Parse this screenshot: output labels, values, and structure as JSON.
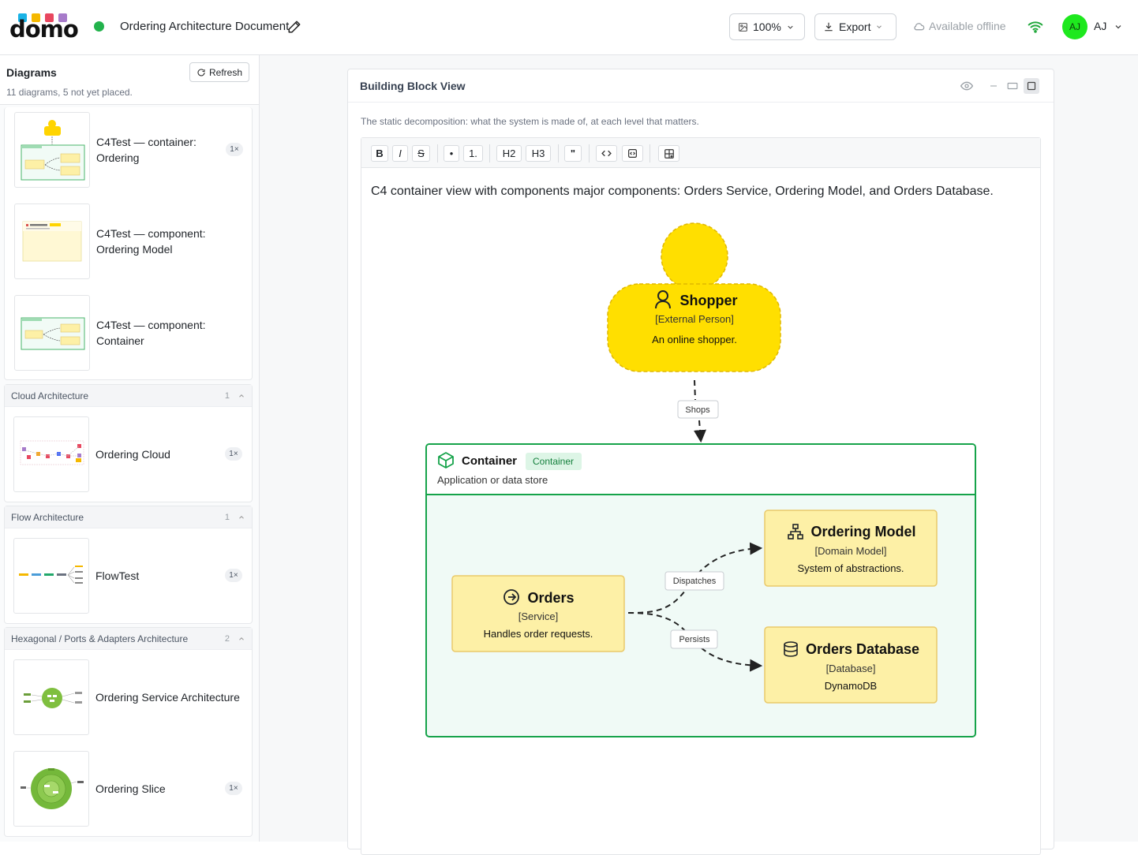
{
  "header": {
    "logo_text": "domo",
    "logo_colors": [
      "#1ab3e6",
      "#f5b800",
      "#e8475f",
      "#a77bca"
    ],
    "status_color": "#22b24c",
    "doc_title": "Ordering Architecture Document",
    "zoom": "100%",
    "export_label": "Export",
    "offline_label": "Available offline",
    "wifi_color": "#22a83c",
    "avatar_initials": "AJ",
    "avatar_color": "#1ee81e",
    "user_label": "AJ"
  },
  "sidebar": {
    "title": "Diagrams",
    "refresh_label": "Refresh",
    "summary": "11 diagrams, 5 not yet placed.",
    "top_items": [
      {
        "label": "C4Test — container: Ordering",
        "badge": "1×"
      },
      {
        "label": "C4Test — component: Ordering Model"
      },
      {
        "label": "C4Test — component: Container"
      }
    ],
    "groups": [
      {
        "name": "Cloud Architecture",
        "count": "1",
        "items": [
          {
            "label": "Ordering Cloud",
            "badge": "1×"
          }
        ]
      },
      {
        "name": "Flow Architecture",
        "count": "1",
        "items": [
          {
            "label": "FlowTest",
            "badge": "1×"
          }
        ]
      },
      {
        "name": "Hexagonal / Ports & Adapters Architecture",
        "count": "2",
        "items": [
          {
            "label": "Ordering Service Architecture"
          },
          {
            "label": "Ordering Slice",
            "badge": "1×"
          }
        ]
      }
    ]
  },
  "main": {
    "card_title": "Building Block View",
    "card_desc": "The static decomposition: what the system is made of, at each level that matters.",
    "toolbar": {
      "bold": "B",
      "italic": "I",
      "strike": "S",
      "bullet": "•",
      "ordered": "1.",
      "h2": "H2",
      "h3": "H3",
      "quote": "\""
    },
    "paragraph": "C4 container view with components major components: Orders Service, Ordering Model, and Orders Database."
  },
  "diagram": {
    "person": {
      "name": "Shopper",
      "type": "[External Person]",
      "desc": "An online shopper.",
      "color": "#ffdf00",
      "border": "#e0b800"
    },
    "edge_shops": "Shops",
    "container": {
      "name": "Container",
      "tag": "Container",
      "desc": "Application or data store",
      "border": "#16a34a",
      "fill": "#f0faf6"
    },
    "orders": {
      "name": "Orders",
      "type": "[Service]",
      "desc": "Handles order requests."
    },
    "model": {
      "name": "Ordering Model",
      "type": "[Domain Model]",
      "desc": "System of abstractions."
    },
    "database": {
      "name": "Orders Database",
      "type": "[Database]",
      "desc": "DynamoDB"
    },
    "edge_dispatches": "Dispatches",
    "edge_persists": "Persists",
    "component_fill": "#fdf0a6",
    "component_border": "#e9c96a"
  }
}
